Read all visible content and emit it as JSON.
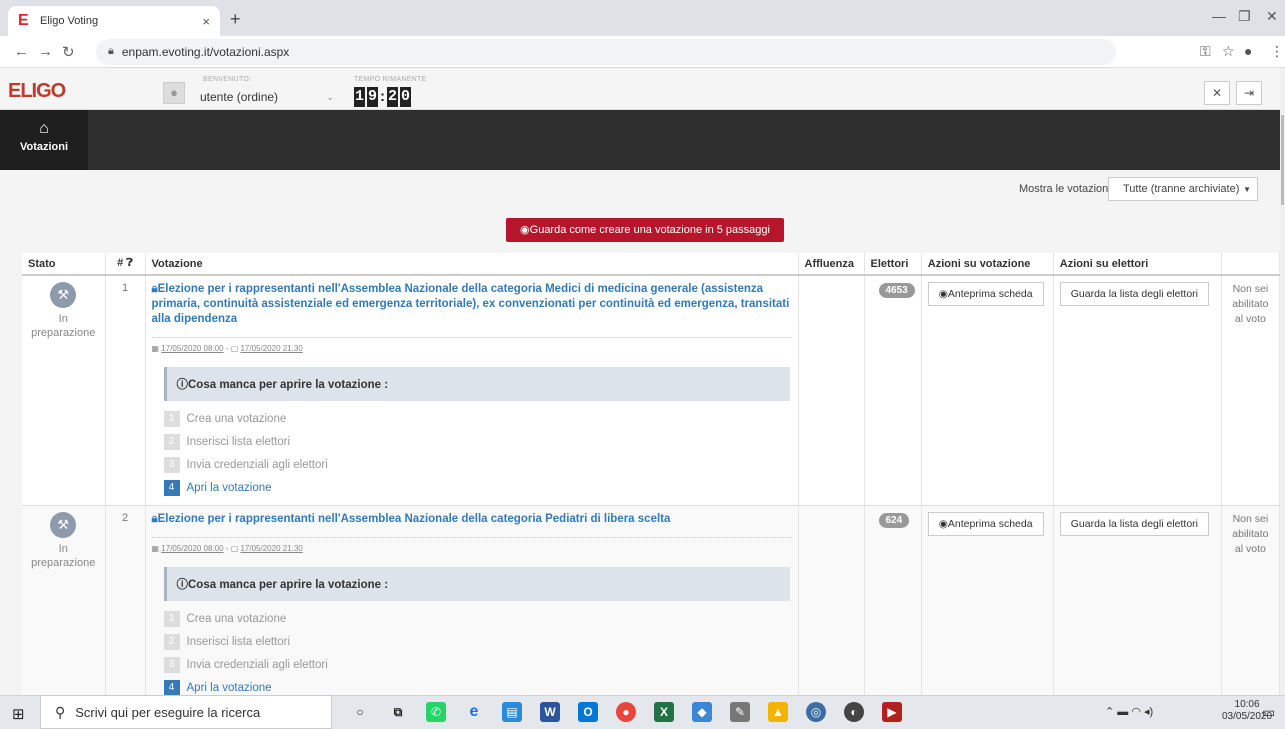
{
  "browser": {
    "tab_title": "Eligo Voting",
    "tab_close": "×",
    "new_tab": "+",
    "url": "enpam.evoting.it/votazioni.aspx",
    "favicon": "E"
  },
  "header": {
    "logo": "ELIGO",
    "welcome_label": "BENVENUTO:",
    "user": "utente (ordine)",
    "time_label": "TEMPO RIMANENTE",
    "time_digits": [
      "1",
      "9",
      "2",
      "0"
    ]
  },
  "nav": {
    "item_label": "Votazioni"
  },
  "filter": {
    "label": "Mostra le votazioni:",
    "value": "Tutte (tranne archiviate)"
  },
  "guide_button": "Guarda come creare una votazione in 5 passaggi",
  "table": {
    "headers": [
      "Stato",
      "#",
      "Votazione",
      "Affluenza",
      "Elettori",
      "Azioni su votazione",
      "Azioni su elettori",
      ""
    ],
    "rows": [
      {
        "stato_line1": "In",
        "stato_line2": "preparazione",
        "num": "1",
        "title": "Elezione per i rappresentanti nell'Assemblea Nazionale della categoria Medici di medicina generale (assistenza primaria, continuità assistenziale ed emergenza territoriale), ex convenzionati per continuità ed emergenza, transitati alla dipendenza",
        "start": "17/05/2020 08:00",
        "end": "17/05/2020 21:30",
        "electors": "4653",
        "preview": "Anteprima scheda",
        "list": "Guarda la lista degli elettori",
        "status": "Non sei abilitato al voto"
      },
      {
        "stato_line1": "In",
        "stato_line2": "preparazione",
        "num": "2",
        "title": "Elezione per i rappresentanti nell'Assemblea Nazionale della categoria Pediatri di libera scelta",
        "start": "17/05/2020 08:00",
        "end": "17/05/2020 21:30",
        "electors": "624",
        "preview": "Anteprima scheda",
        "list": "Guarda la lista degli elettori",
        "status": "Non sei abilitato al voto"
      }
    ]
  },
  "missing_title": "Cosa manca per aprire la votazione :",
  "steps": [
    {
      "n": "1",
      "label": "Crea una votazione"
    },
    {
      "n": "2",
      "label": "Inserisci lista elettori"
    },
    {
      "n": "3",
      "label": "Invia credenziali agli elettori"
    },
    {
      "n": "4",
      "label": "Apri la votazione"
    }
  ],
  "taskbar": {
    "search": "Scrivi qui per eseguire la ricerca",
    "time": "10:06",
    "date": "03/05/2020"
  }
}
